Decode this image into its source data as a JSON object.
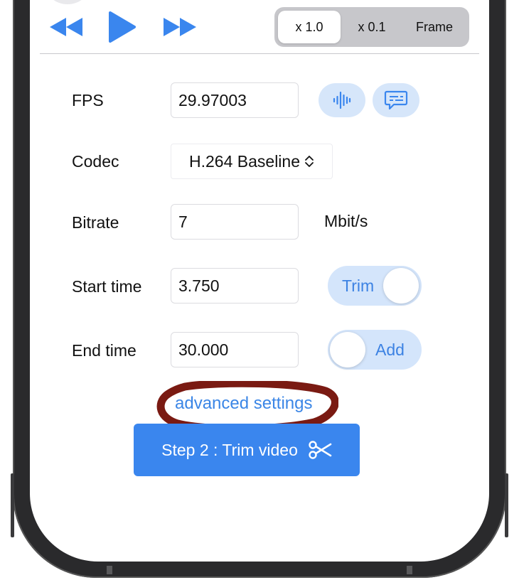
{
  "playback": {
    "icons": {
      "rewind": "rewind-icon",
      "play": "play-icon",
      "fast_forward": "fast-forward-icon"
    },
    "speed_options": [
      "x 1.0",
      "x 0.1",
      "Frame"
    ],
    "selected_speed": "x 1.0"
  },
  "form": {
    "fps": {
      "label": "FPS",
      "value": "29.97003",
      "icons": [
        "waveform-icon",
        "subtitle-bubble-icon"
      ]
    },
    "codec": {
      "label": "Codec",
      "value": "H.264 Baseline"
    },
    "bitrate": {
      "label": "Bitrate",
      "value": "7",
      "unit": "Mbit/s"
    },
    "start_time": {
      "label": "Start time",
      "value": "3.750",
      "toggle_label": "Trim"
    },
    "end_time": {
      "label": "End time",
      "value": "30.000",
      "toggle_label": "Add"
    }
  },
  "advanced_link": "advanced settings",
  "primary_button": {
    "label": "Step 2 : Trim video",
    "icon": "scissors-icon"
  },
  "colors": {
    "accent": "#3a86ee",
    "accent_light": "#d4e5fb",
    "annotation": "#7a1a12"
  }
}
